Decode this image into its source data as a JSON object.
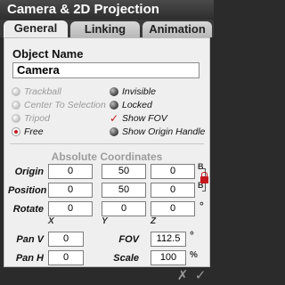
{
  "window": {
    "title": "Camera & 2D Projection"
  },
  "tabs": [
    {
      "label": "General",
      "active": true
    },
    {
      "label": "Linking",
      "active": false
    },
    {
      "label": "Animation",
      "active": false
    }
  ],
  "object": {
    "heading": "Object Name",
    "value": "Camera"
  },
  "options": {
    "left": [
      {
        "label": "Trackball",
        "state": "disabled"
      },
      {
        "label": "Center To Selection",
        "state": "disabled"
      },
      {
        "label": "Tripod",
        "state": "disabled"
      },
      {
        "label": "Free",
        "state": "selected"
      }
    ],
    "right": [
      {
        "label": "Invisible",
        "state": "off"
      },
      {
        "label": "Locked",
        "state": "off"
      },
      {
        "label": "Show FOV",
        "state": "checked"
      },
      {
        "label": "Show Origin Handle",
        "state": "off"
      }
    ]
  },
  "coords": {
    "heading": "Absolute Coordinates",
    "rows": [
      {
        "label": "Origin",
        "values": [
          "0",
          "50",
          "0"
        ],
        "suffix": "B"
      },
      {
        "label": "Position",
        "values": [
          "0",
          "50",
          "0"
        ],
        "suffix": "B"
      },
      {
        "label": "Rotate",
        "values": [
          "0",
          "0",
          "0"
        ],
        "suffix": "°"
      }
    ],
    "axes": [
      "X",
      "Y",
      "Z"
    ]
  },
  "pan": {
    "v_label": "Pan V",
    "v_value": "0",
    "h_label": "Pan H",
    "h_value": "0",
    "fov_label": "FOV",
    "fov_value": "112.5",
    "fov_suffix": "°",
    "scale_label": "Scale",
    "scale_value": "100",
    "scale_suffix": "%"
  },
  "footer": {
    "cancel": "✗",
    "ok": "✓"
  },
  "colors": {
    "accent": "#c4161c",
    "titlebar": "#2e2e2e",
    "panel": "#efefef"
  }
}
